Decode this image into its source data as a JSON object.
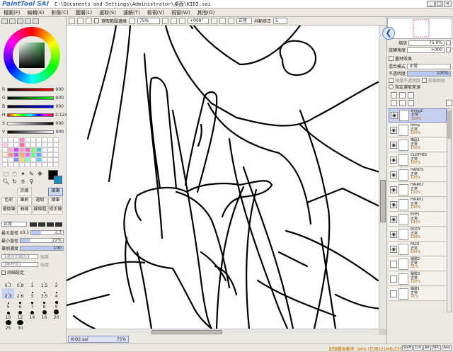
{
  "window": {
    "logo": "PaintTool",
    "brand": "SAI",
    "path": "C:\\Documents and Settings\\Administrator\\桌面\\KIO2.sai"
  },
  "menu": [
    "檔案(F)",
    "編輯(E)",
    "影像(C)",
    "圖層(L)",
    "選取(S)",
    "濾鏡(T)",
    "檢視(V)",
    "視窗(W)",
    "其他(O)"
  ],
  "toolbar": {
    "selection_label": "選取範圍邊緣",
    "zoom": "75%",
    "angle": "+000°",
    "mode": "正常",
    "stabilizer_label": "抖動修正",
    "stabilizer_value": "5"
  },
  "color": {
    "rgb": [
      {
        "label": "R",
        "value": "000"
      },
      {
        "label": "G",
        "value": "000"
      },
      {
        "label": "B",
        "value": "000"
      }
    ],
    "hsv": [
      {
        "label": "H",
        "value": "2:124"
      },
      {
        "label": "S",
        "value": "000"
      },
      {
        "label": "V",
        "value": "000"
      }
    ],
    "swatches": [
      "#ffffff",
      "#ffffff",
      "#ffffff",
      "#ff88cc",
      "#ffffff",
      "#ffffff",
      "#ffffff",
      "#ffffff",
      "#ffffff",
      "#ffffff",
      "#ffccee",
      "#ffffff",
      "#ffffff",
      "#ff66aa",
      "#ffffff",
      "#ffffff",
      "#ffffff",
      "#ffffff",
      "#ffffff",
      "#ffffff",
      "#ffffff",
      "#ffaacc",
      "#cc44ff",
      "#ff99cc",
      "#ff66cc",
      "#88ff66",
      "#44cccc",
      "#ffffff",
      "#ffffff",
      "#ffffff",
      "#ffeedd",
      "#ff8888",
      "#aa66ff",
      "#ffaa66",
      "#ff66ff",
      "#66ff88",
      "#66aaff",
      "#ffffff",
      "#ffffff",
      "#ffffff",
      "#ffffff",
      "#ffffff",
      "#8888ff",
      "#ffdd66",
      "#88ffcc",
      "#ffffff",
      "#66ccff",
      "#ffffff",
      "#ffffff",
      "#ffffff",
      "#ffffff",
      "#ffffff",
      "#ffffff",
      "#ffffff",
      "#ffffff",
      "#ffffff",
      "#ffffff",
      "#ffffff",
      "#ffffff",
      "#ffffff"
    ]
  },
  "tools": [
    "折線",
    "鋼筆",
    "色彩",
    "鋼筆",
    "選取",
    "色彩",
    "鋼筆",
    "曲線",
    "線條",
    "修正",
    "選取筆",
    "曲線",
    "修正",
    "修正線"
  ],
  "tool_labels": {
    "row1": [
      "折線",
      "鋼筆"
    ],
    "row2": [
      "色彩",
      "筆刷",
      "選取",
      "鋼筆"
    ],
    "row3": [
      "選取筆",
      "曲線",
      "線條粗",
      "修正線"
    ]
  },
  "brush": {
    "mode": "正常",
    "max_size_label": "最大直徑",
    "max_size_value": "2.3",
    "max_size_mult": "x0.1",
    "min_size_label": "最小直徑",
    "min_size_value": "22%",
    "density_label": "筆刷濃度",
    "density_value": "100",
    "opt1": "【通常的圓形】",
    "opt1_v": "強度",
    "opt2": "【無材質】",
    "opt2_v": "強度",
    "detail_label": "詳細設定",
    "sizes": [
      "0.7",
      "0.8",
      "1",
      "1.5",
      "2",
      "2.3",
      "2.6",
      "3",
      "3.5",
      "4",
      "5",
      "6",
      "7",
      "8",
      "9",
      "10",
      "12",
      "14",
      "16",
      "20",
      "25",
      "30"
    ],
    "size_fraction": [
      0.05,
      0.06,
      0.07,
      0.09,
      0.1,
      0.11,
      0.12,
      0.14,
      0.15,
      0.17,
      0.2,
      0.22,
      0.25,
      0.28,
      0.3,
      0.33,
      0.38,
      0.43,
      0.47,
      0.55,
      0.65,
      0.75
    ]
  },
  "canvas_tab": {
    "name": "KIO2.sai",
    "zoom": "75%"
  },
  "status": {
    "memory": "記憶體負載率: 94% (已用221MB/235MB)",
    "keys": [
      "Shift",
      "Ctrl",
      "Alt",
      "SPC",
      "Any"
    ]
  },
  "nav": {
    "zoom_label": "縮放",
    "zoom_value": "75.0%",
    "angle_label": "旋轉角度",
    "angle_value": "+000",
    "effects_label": "畫材效果"
  },
  "layer_panel": {
    "blend_label": "混合模式",
    "blend_value": "正常",
    "opacity_label": "不透明度",
    "opacity_value": "100%",
    "protect_label": "保護不透明度",
    "clip_label": "剪裁群組",
    "sel_source": "指定選取來源"
  },
  "layers": [
    {
      "name": "thing2",
      "mode": "正常",
      "opacity": "100%",
      "visible": true,
      "active": true
    },
    {
      "name": "thing",
      "mode": "正常",
      "opacity": "100%",
      "visible": true,
      "active": false
    },
    {
      "name": "嘴唇1",
      "mode": "正常",
      "opacity": "100%",
      "visible": true,
      "active": false
    },
    {
      "name": "CLOTHES",
      "mode": "正常",
      "opacity": "100%",
      "visible": true,
      "active": false
    },
    {
      "name": "HANDS",
      "mode": "正常",
      "opacity": "100%",
      "visible": true,
      "active": false
    },
    {
      "name": "HAIR02",
      "mode": "正常",
      "opacity": "100%",
      "visible": true,
      "active": false
    },
    {
      "name": "HAIR01",
      "mode": "正常",
      "opacity": "100%",
      "visible": true,
      "active": false
    },
    {
      "name": "EYES",
      "mode": "正常",
      "opacity": "100%",
      "visible": true,
      "active": false
    },
    {
      "name": "BODY",
      "mode": "正常",
      "opacity": "100%",
      "visible": true,
      "active": false
    },
    {
      "name": "FACE",
      "mode": "正常",
      "opacity": "100%",
      "visible": true,
      "active": false
    },
    {
      "name": "圖層2",
      "mode": "正常",
      "opacity": "51%",
      "visible": false,
      "active": false
    },
    {
      "name": "圖層3",
      "mode": "正常",
      "opacity": "100%",
      "visible": false,
      "active": false
    },
    {
      "name": "圖層1",
      "mode": "正常",
      "opacity": "31%",
      "visible": false,
      "active": false
    }
  ]
}
